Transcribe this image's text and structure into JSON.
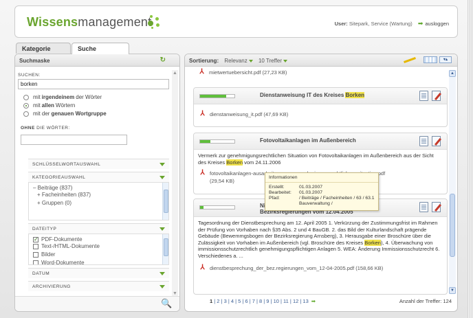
{
  "header": {
    "logo_bold": "Wissens",
    "logo_rest": "management",
    "user_label": "User:",
    "user_value": "Sitepark, Service (Wartung)",
    "logout": "ausloggen"
  },
  "tabs": [
    {
      "label": "Kategorie"
    },
    {
      "label": "Suche"
    }
  ],
  "left": {
    "title": "Suchmaske",
    "search_label": "SUCHEN:",
    "search_value": "borken",
    "radio1_pre": "mit ",
    "radio1_bold": "irgendeinem",
    "radio1_post": " der Wörter",
    "radio2_pre": "mit ",
    "radio2_bold": "allen",
    "radio2_post": " Wörtern",
    "radio3_pre": "mit der ",
    "radio3_bold": "genauen Wortgruppe",
    "without_bold": "OHNE",
    "without_rest": " DIE WÖRTER:",
    "without_value": "",
    "sections": {
      "keywords": "SCHLÜSSELWORTAUSWAHL",
      "categories": "KATEGORIEAUSWAHL",
      "filetype": "DATEITYP",
      "date": "DATUM",
      "archive": "ARCHIVIERUNG"
    },
    "category_items": [
      "– Beiträge (837)",
      "+ Facheinheiten (837)",
      "+ Gruppen (0)"
    ],
    "filetype_items": [
      "PDF-Dokumente",
      "Text-/HTML-Dokumente",
      "Bilder",
      "Word-Dokumente"
    ],
    "filetype_checked": [
      true,
      false,
      false,
      false
    ]
  },
  "right": {
    "sort_label": "Sortierung:",
    "sort_value": "Relevanz",
    "hits_value": "10 Treffer",
    "top_file": "mietwertuebersicht.pdf (27,23 KB)",
    "results": [
      {
        "title_pre": "Dienstanweisung IT des Kreises ",
        "title_hl": "Borken",
        "title_post": "",
        "bar": 0.75,
        "file": "dienstanweisung_it.pdf (47,69 KB)"
      },
      {
        "title_pre": "Fotovoltaikanlagen im Außenbereich",
        "title_hl": "",
        "title_post": "",
        "bar": 0.3,
        "snippet_pre": "Vermerk zur genehmigungsrechtlichen Situation von Fotovoltaikanlagen im Außenbereich aus der Sicht des Kreises ",
        "snippet_hl": "Borken",
        "snippet_post": " vom 24.11.2006",
        "file": "fotovoltaikanlagen-ausarbeitung_zur_genehmigungsrechtlichen_situation.pdf",
        "file_size": "(29,54 KB)"
      },
      {
        "title_line1": "Niede",
        "title_line2": "Bezirksregierungen vom 12.04.2005",
        "bar": 0.1,
        "snippet_pre": "Tagesordnung der Dienstbesprechung am 12. April 2005 1. Verkürzung der Zustimmungsfrist im Rahmen der Prüfung von Vorhaben nach §35 Abs. 2 und 4 BauGB. 2. das Bild der Kulturlandschaft prägende Gebäude (Bewemmgsbogen der Bezirksregierung Arnsberg), 3. Herausgabe einer Broschüre über die Zulässigkeit von Vorhaben im Außenbereich (vgl. Broschüre des Kreises ",
        "snippet_hl": "Borken",
        "snippet_post": "), 4. Überwachung von immissionsschutzrechtlich genehmigungspflichtigen Anlagen 5. WEA: Änderung Immissionsschutzrecht 6. Verschiedenes a. ...",
        "file": "dienstbesprechung_der_bez.regierungen_vom_12-04-2005.pdf (158,66 KB)"
      }
    ],
    "tooltip": {
      "title": "Informationen",
      "created_label": "Erstellt:",
      "created": "01.03.2007",
      "edited_label": "Bearbeitet:",
      "edited": "01.03.2007",
      "path_label": "Pfad:",
      "path": "/ Beiträge / Facheinheiten / 63 / 63.1 Bauverwaltung /"
    },
    "pager": {
      "current": "1",
      "pages": "| 2 | 3 | 4 | 5 | 6 | 7 | 8 | 9 | 10 | 11 | 12 | 13",
      "total": "Anzahl der Treffer: 124"
    }
  },
  "colors": {
    "accent": "#6aa52f",
    "highlight": "#f2e34a",
    "link": "#3a5e94"
  },
  "icons": [
    "green-dots-logo-icon",
    "arrow-right-icon",
    "refresh-icon",
    "magnifier-icon",
    "pencil-icon",
    "view-toggle-icon",
    "collapse-icon",
    "pdf-icon",
    "document-icon",
    "edit-icon"
  ]
}
